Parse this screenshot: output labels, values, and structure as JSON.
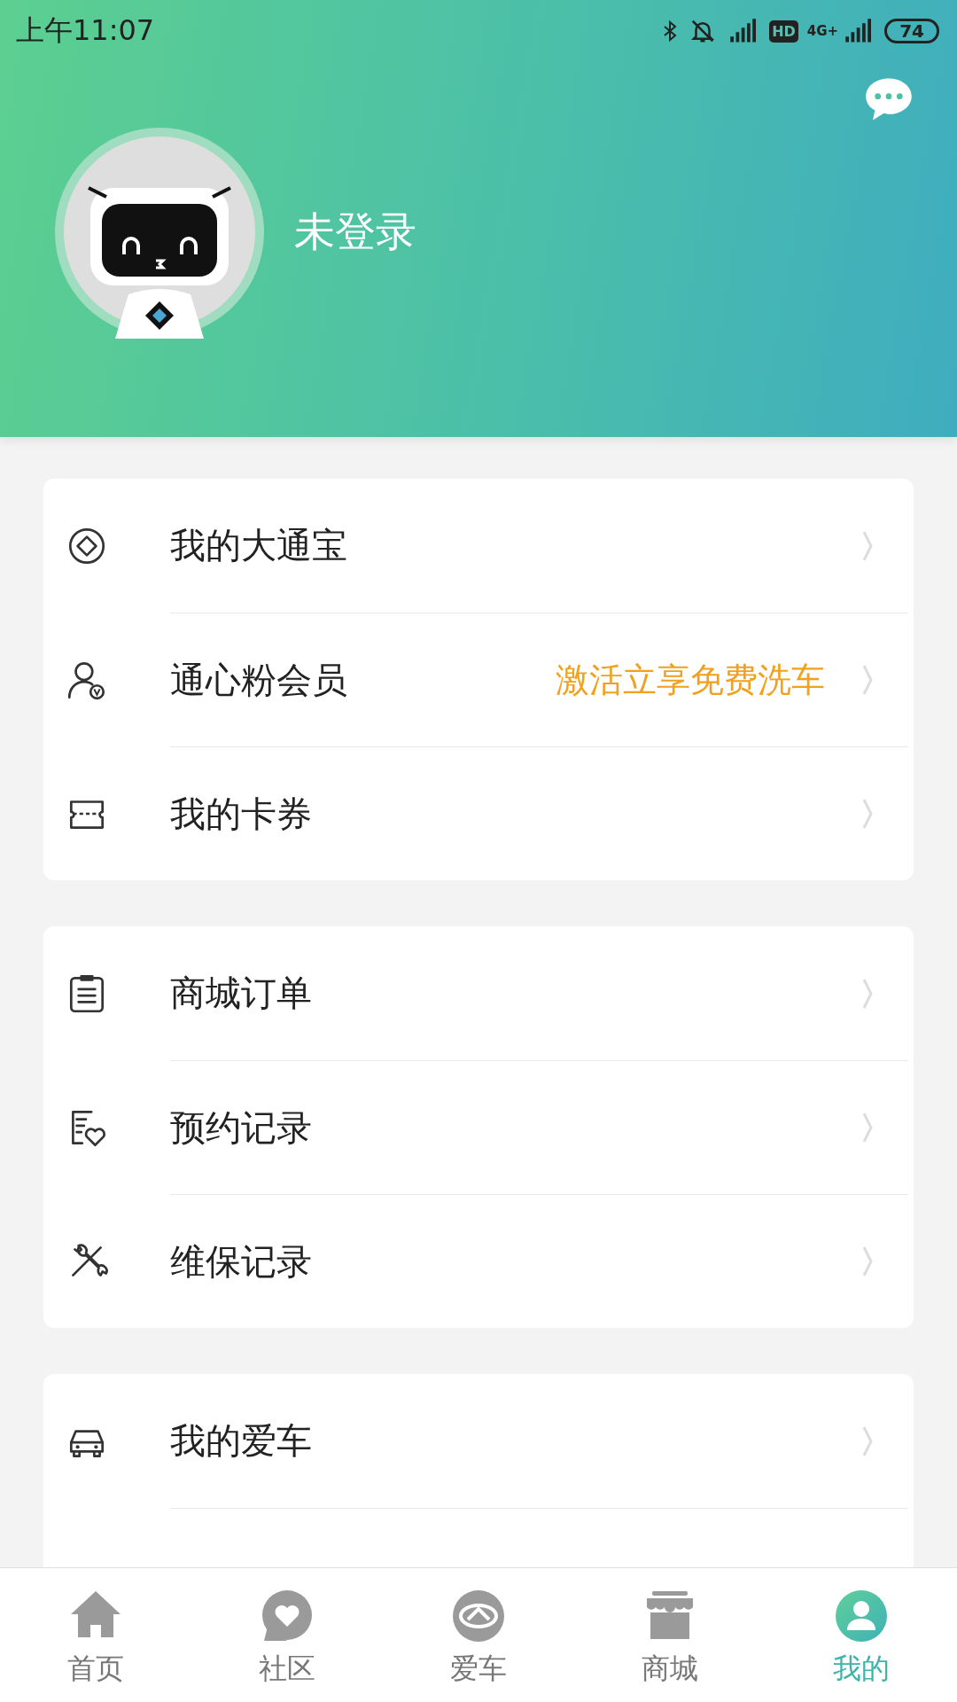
{
  "status_bar": {
    "time": "上午11:07",
    "hd": "HD",
    "network": "4G+",
    "battery": "74"
  },
  "profile": {
    "name": "未登录"
  },
  "sections": [
    {
      "rows": [
        {
          "label": "我的大通宝"
        },
        {
          "label": "通心粉会员",
          "hint": "激活立享免费洗车"
        },
        {
          "label": "我的卡券"
        }
      ]
    },
    {
      "rows": [
        {
          "label": "商城订单"
        },
        {
          "label": "预约记录"
        },
        {
          "label": "维保记录"
        }
      ]
    },
    {
      "rows": [
        {
          "label": "我的爱车"
        }
      ],
      "continues": true
    }
  ],
  "tabs": [
    {
      "label": "首页",
      "selected": false
    },
    {
      "label": "社区",
      "selected": false
    },
    {
      "label": "爱车",
      "selected": false
    },
    {
      "label": "商城",
      "selected": false
    },
    {
      "label": "我的",
      "selected": true
    }
  ]
}
